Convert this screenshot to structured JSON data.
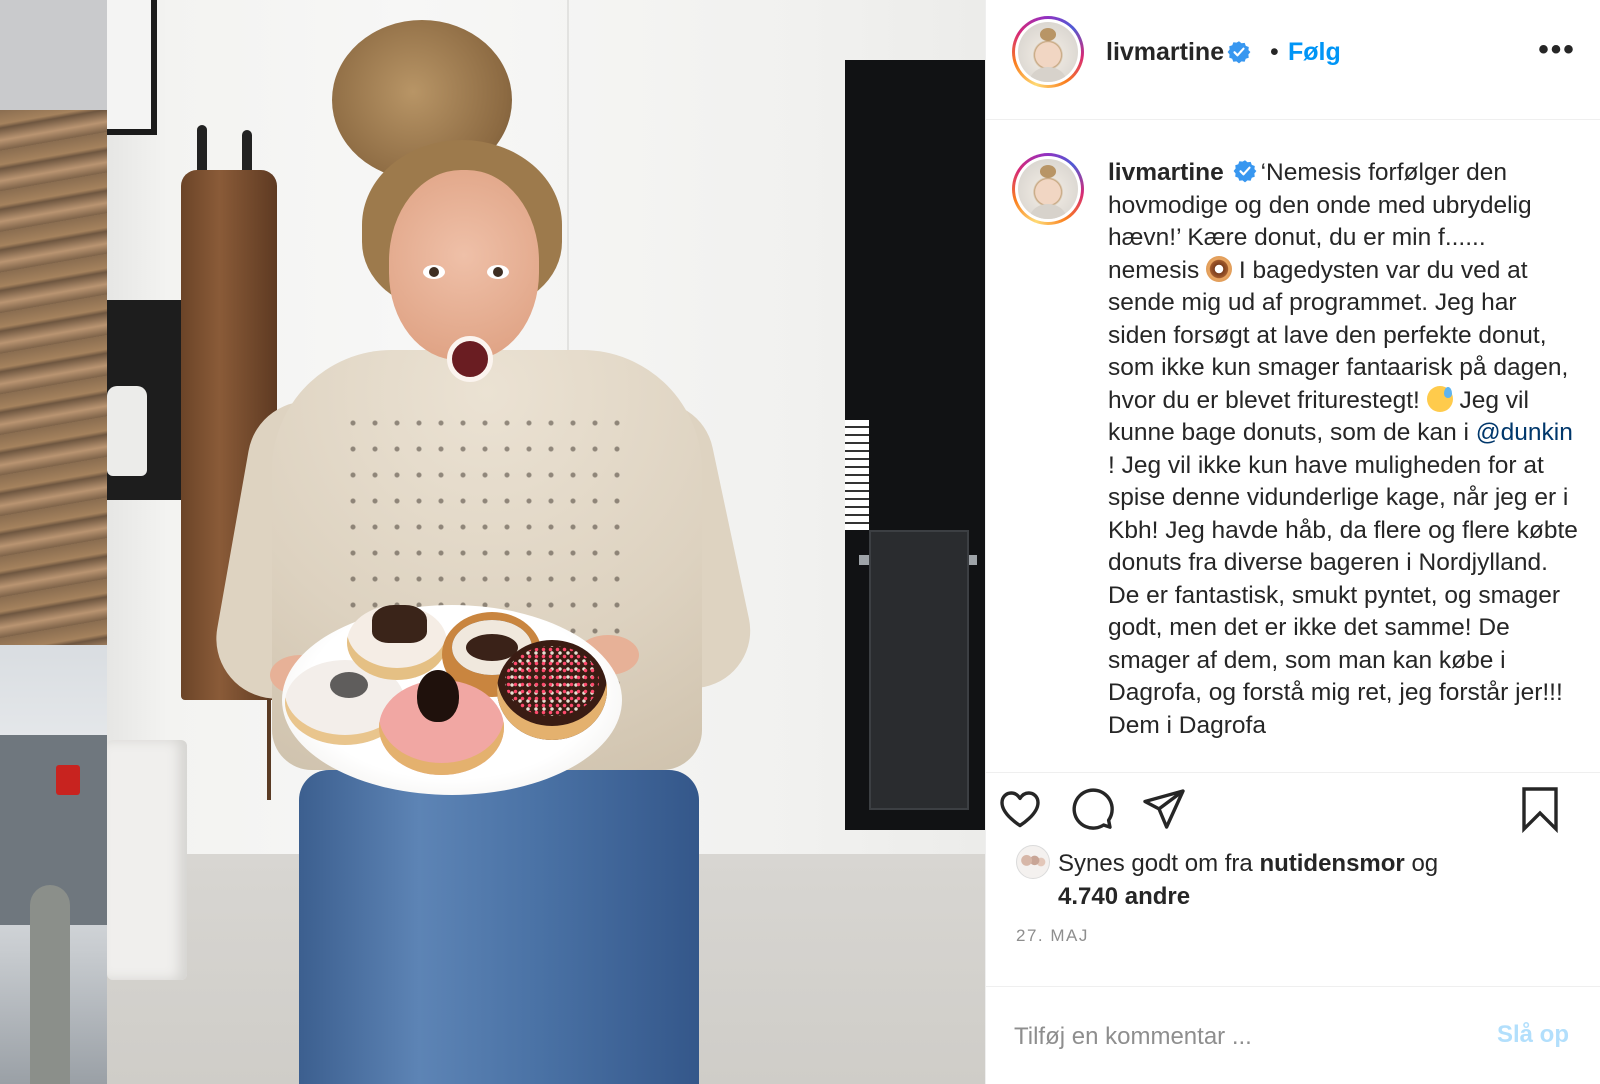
{
  "post": {
    "username": "livmartine",
    "separator": "•",
    "follow_label": "Følg",
    "more_label": "•••",
    "caption": {
      "username": "livmartine",
      "text_1": "‘Nemesis forfølger den hovmodige og den onde med ubrydelig hævn!’ Kære donut, du er min f...... nemesis ",
      "emoji_1": "donut-emoji",
      "text_2": " I bagedysten var du ved at sende mig ud af programmet. Jeg har siden forsøgt at lave den perfekte donut, som ikke kun smager fantaarisk på dagen, hvor du er blevet friturestegt! ",
      "emoji_2": "sweat-smile-emoji",
      "text_3": " Jeg vil kunne bage donuts, som de kan i ",
      "mention": "@dunkin",
      "text_4": " ! Jeg vil ikke kun have muligheden for at spise denne vidunderlige kage, når jeg er i Kbh! Jeg havde håb, da flere og flere købte donuts fra diverse bageren i Nordjylland. De er fantastisk, smukt pyntet, og smager godt, men det er ikke det samme! De smager af dem, som man kan købe i Dagrofa, og forstå mig ret, jeg forstår jer!!! Dem i Dagrofa"
    },
    "actions": {
      "like_icon": "heart-icon",
      "comment_icon": "comment-icon",
      "share_icon": "send-icon",
      "save_icon": "bookmark-icon"
    },
    "likes": {
      "prefix": "Synes godt om fra ",
      "liker": "nutidensmor",
      "mid": " og",
      "count": "4.740 andre"
    },
    "date": "27. MAJ",
    "comment": {
      "placeholder": "Tilføj en kommentar ...",
      "post_label": "Slå op"
    }
  },
  "colors": {
    "link_blue": "#0095f6",
    "mention_blue": "#00376b",
    "verified_blue": "#3897f0",
    "text": "#262626",
    "muted": "#8e8e8e",
    "disabled_post": "#b2dffc"
  }
}
